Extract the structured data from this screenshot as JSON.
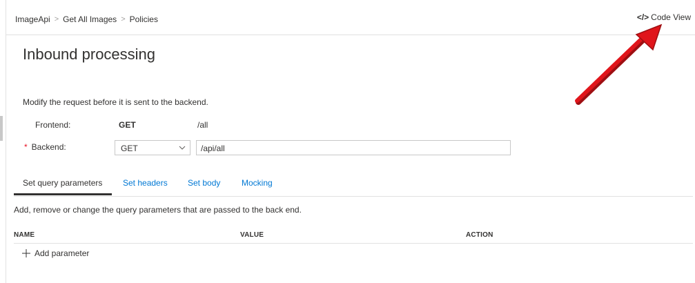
{
  "breadcrumb": {
    "items": [
      "ImageApi",
      "Get All Images",
      "Policies"
    ],
    "separator": ">"
  },
  "code_view": {
    "icon": "</>",
    "label": "Code View"
  },
  "page_title": "Inbound processing",
  "description": "Modify the request before it is sent to the backend.",
  "frontend": {
    "label": "Frontend:",
    "method": "GET",
    "path": "/all"
  },
  "backend": {
    "required_mark": "*",
    "label": "Backend:",
    "method": "GET",
    "path": "/api/all"
  },
  "tabs": [
    {
      "label": "Set query parameters",
      "active": true
    },
    {
      "label": "Set headers",
      "active": false
    },
    {
      "label": "Set body",
      "active": false
    },
    {
      "label": "Mocking",
      "active": false
    }
  ],
  "section_description": "Add, remove or change the query parameters that are passed to the back end.",
  "table": {
    "columns": [
      "NAME",
      "VALUE",
      "ACTION"
    ]
  },
  "add_parameter_label": "Add parameter",
  "colors": {
    "link": "#0078d4",
    "required": "#e81123",
    "arrow": "#e0151b",
    "text": "#323130"
  }
}
